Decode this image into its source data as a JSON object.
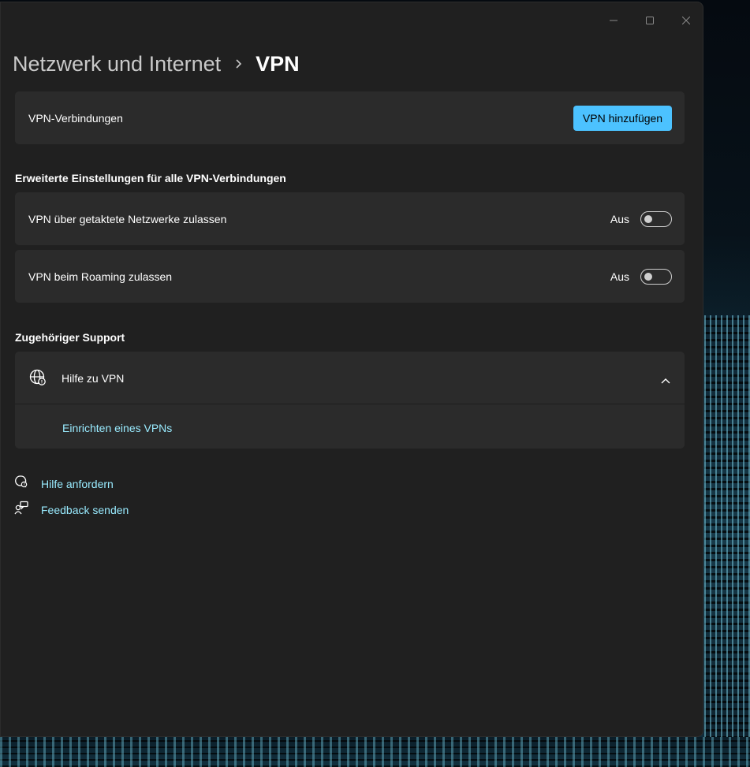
{
  "window": {
    "caption_minimize": "minimize-icon",
    "caption_maximize": "maximize-icon",
    "caption_close": "close-icon"
  },
  "breadcrumb": {
    "parent": "Netzwerk und Internet",
    "current": "VPN"
  },
  "vpn_connections": {
    "label": "VPN-Verbindungen",
    "add_button": "VPN hinzufügen"
  },
  "advanced": {
    "title": "Erweiterte Einstellungen für alle VPN-Verbindungen",
    "settings": [
      {
        "label": "VPN über getaktete Netzwerke zulassen",
        "state": "Aus",
        "on": false
      },
      {
        "label": "VPN beim Roaming zulassen",
        "state": "Aus",
        "on": false
      }
    ]
  },
  "support": {
    "title": "Zugehöriger Support",
    "expander_label": "Hilfe zu VPN",
    "expander_icon": "globe-icon",
    "links": [
      "Einrichten eines VPNs"
    ]
  },
  "footer_links": [
    {
      "label": "Hilfe anfordern",
      "icon": "help-chat-icon"
    },
    {
      "label": "Feedback senden",
      "icon": "feedback-icon"
    }
  ],
  "colors": {
    "accent": "#4cc2ff",
    "link": "#99ebff",
    "window_bg": "#202020",
    "card_bg": "#2b2b2b"
  }
}
